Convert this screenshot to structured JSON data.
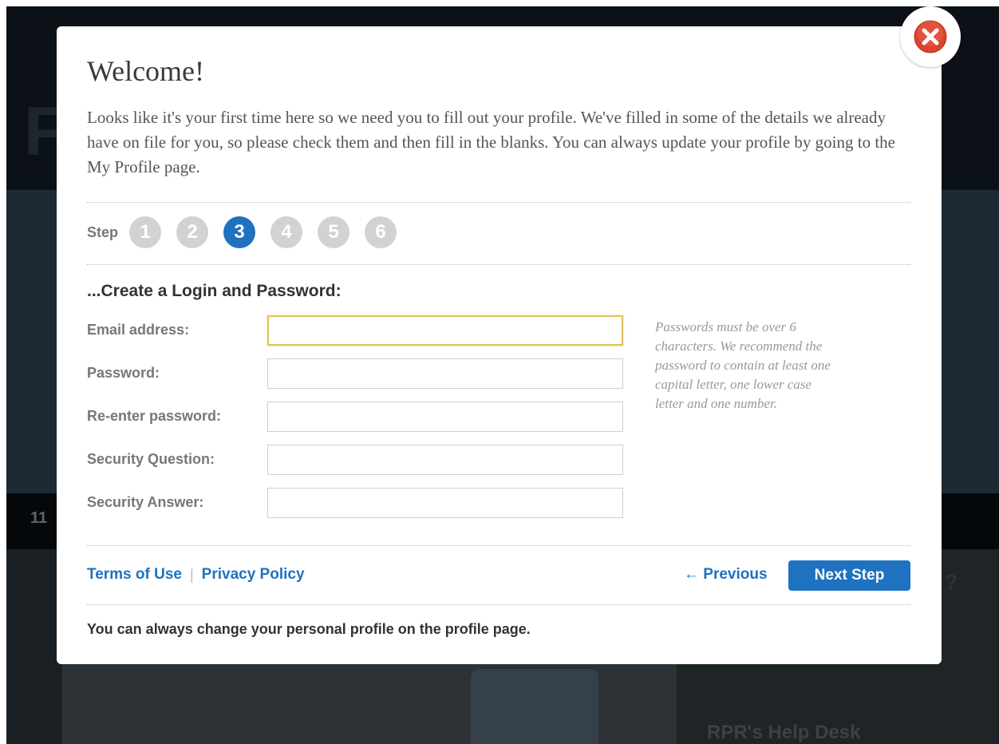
{
  "backdrop": {
    "logo_fragment": "F",
    "darkbar_text": "11",
    "right_panel_text": "RPR's Help Desk",
    "question_mark": "?"
  },
  "modal": {
    "title": "Welcome!",
    "intro": "Looks like it's your first time here so we need you to fill out your profile. We've filled in some of the details we already have on file for you, so please check them and then fill in the blanks. You can always update your profile by going to the My Profile page.",
    "close_icon": "close-icon",
    "steps": {
      "label": "Step",
      "items": [
        "1",
        "2",
        "3",
        "4",
        "5",
        "6"
      ],
      "active": 3
    },
    "section_heading": "...Create a Login and Password:",
    "fields": [
      {
        "label": "Email address:",
        "value": ""
      },
      {
        "label": "Password:",
        "value": ""
      },
      {
        "label": "Re-enter password:",
        "value": ""
      },
      {
        "label": "Security Question:",
        "value": ""
      },
      {
        "label": "Security Answer:",
        "value": ""
      }
    ],
    "password_hint": "Passwords must be over 6 characters. We recommend the password to contain at least one capital letter, one lower case letter and one number.",
    "footer": {
      "terms": "Terms of Use",
      "separator": "|",
      "privacy": "Privacy Policy",
      "previous": "← Previous",
      "next": "Next Step",
      "note": "You can always change your personal profile on the profile page."
    }
  },
  "colors": {
    "accent": "#1e72bf",
    "step_inactive": "#d2d2d2",
    "close_red": "#d9432f",
    "focus_border": "#e0c060"
  }
}
